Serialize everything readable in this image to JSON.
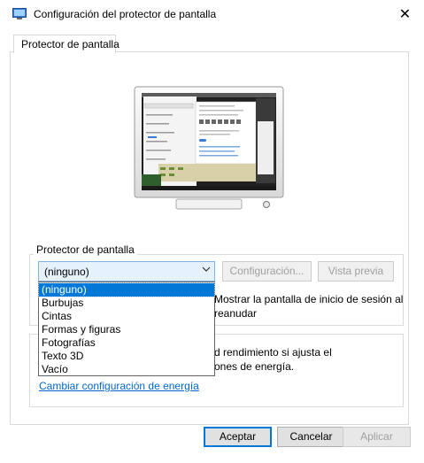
{
  "window": {
    "title": "Configuración del protector de pantalla",
    "close_glyph": "✕"
  },
  "tabs": [
    {
      "label": "Protector de pantalla"
    }
  ],
  "screensaver_group": {
    "label": "Protector de pantalla",
    "selected": "(ninguno)",
    "config_button": "Configuración...",
    "preview_button": "Vista previa",
    "show_login_line1": "Mostrar la pantalla de inicio de sesión al",
    "show_login_line2": "reanudar"
  },
  "dropdown": {
    "options": [
      "(ninguno)",
      "Burbujas",
      "Cintas",
      "Formas y figuras",
      "Fotografías",
      "Texto 3D",
      "Vacío"
    ],
    "highlighted_index": 0
  },
  "energy_group": {
    "line1": "d rendimiento si ajusta el",
    "line2": "ones de energía.",
    "link": "Cambiar configuración de energía"
  },
  "buttons": {
    "ok": "Aceptar",
    "cancel": "Cancelar",
    "apply": "Aplicar"
  },
  "colors": {
    "accent": "#0078d7",
    "link": "#0066cc",
    "disabled_text": "#a0a0a0"
  }
}
